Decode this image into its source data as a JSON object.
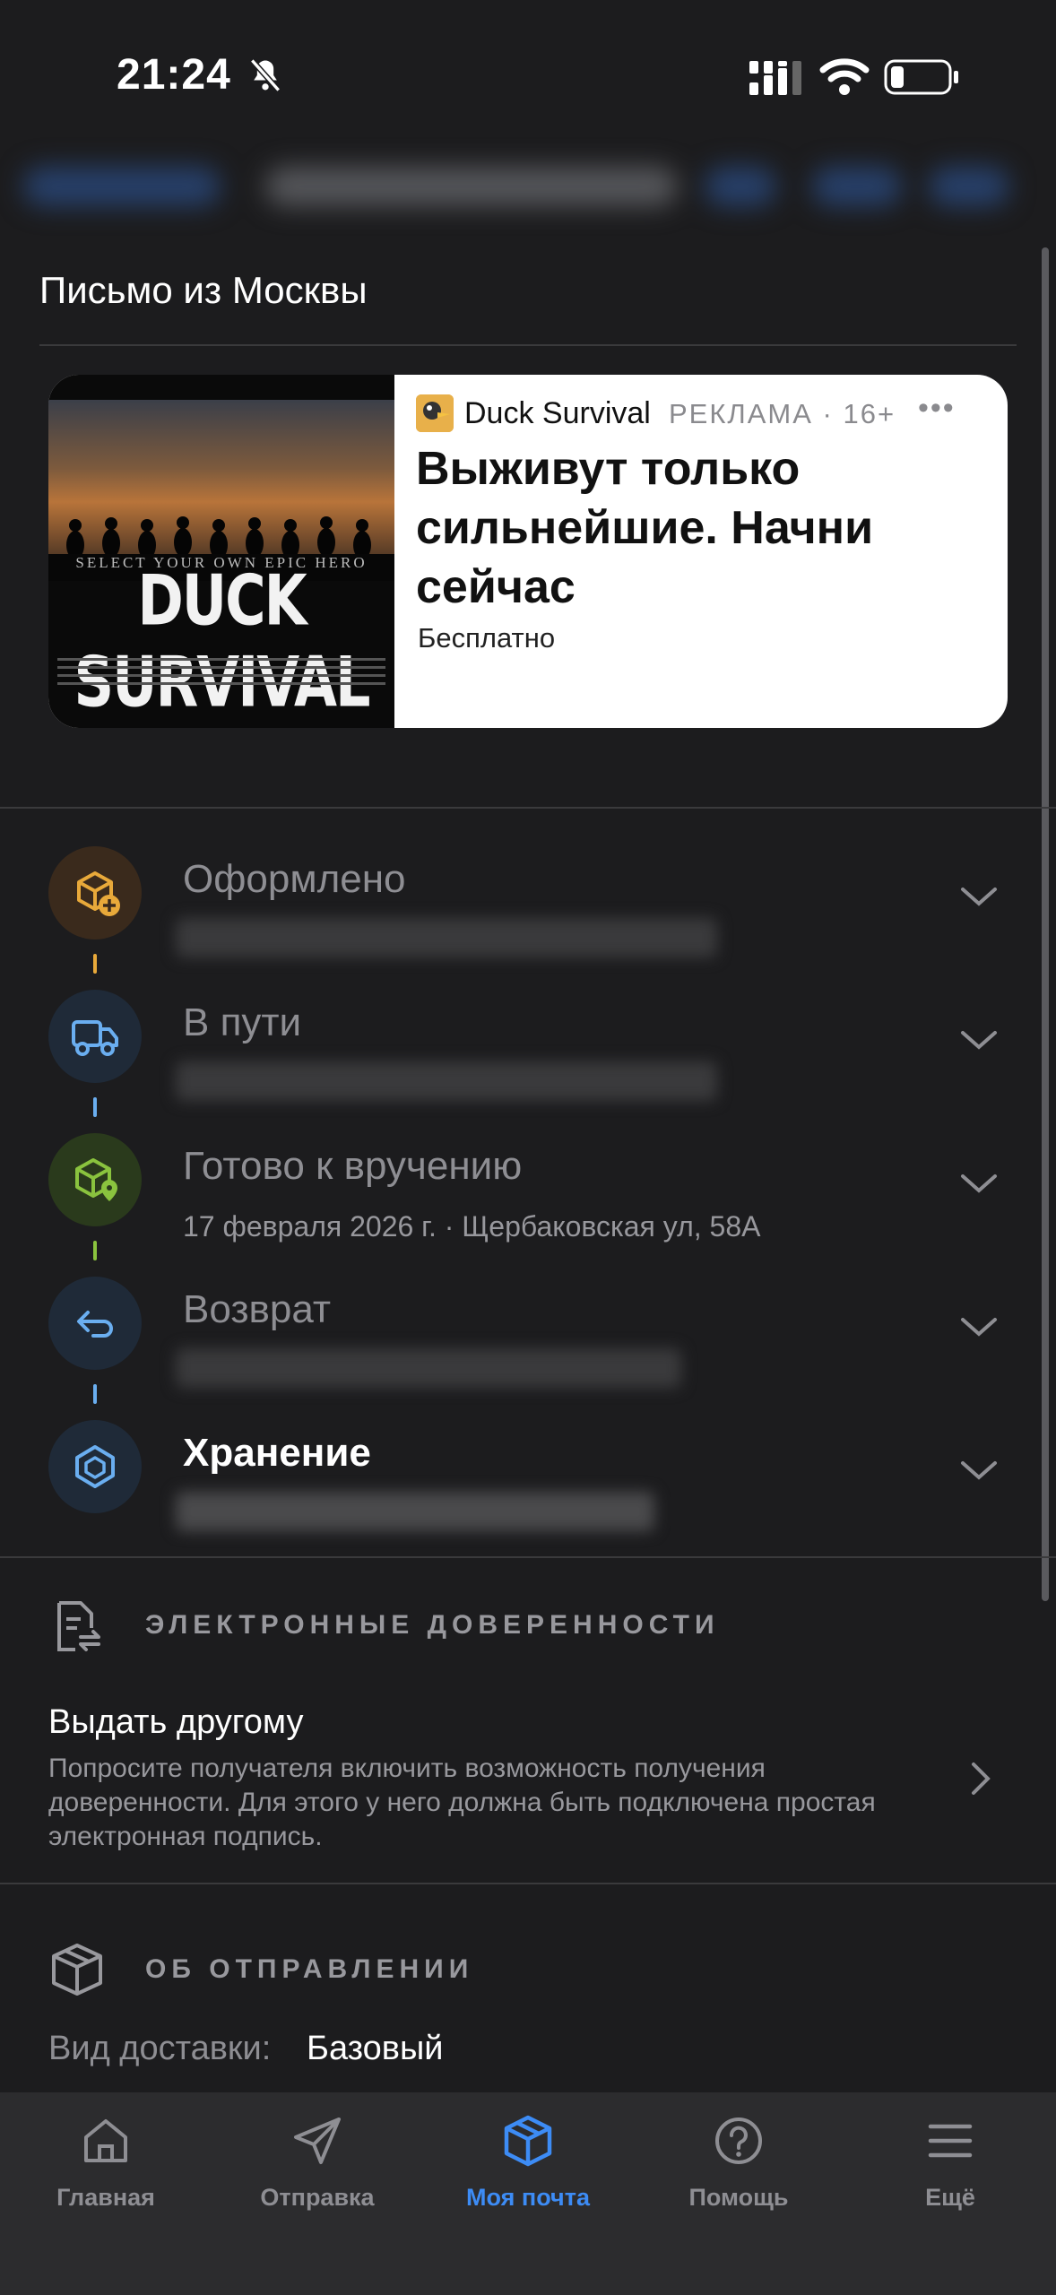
{
  "status_bar": {
    "time": "21:24"
  },
  "page_title": "Письмо из Москвы",
  "ad": {
    "brand": "Duck Survival",
    "label": "РЕКЛАМА",
    "age": "16+",
    "headline": "Выживут только сильнейшие. Начни сейчас",
    "price": "Бесплатно",
    "image_subtitle": "SELECT YOUR OWN EPIC HERO",
    "image_logo": "DUCK SURVIVAL"
  },
  "timeline": {
    "steps": [
      {
        "title": "Оформлено",
        "icon": "package-plus-icon",
        "color": "#e8a93a"
      },
      {
        "title": "В пути",
        "icon": "truck-icon",
        "color": "#6aaef0"
      },
      {
        "title": "Готово к вручению",
        "detail": "17 февраля 2026 г. · Щербаковская ул, 58А",
        "icon": "package-location-icon",
        "color": "#8ac33e"
      },
      {
        "title": "Возврат",
        "icon": "return-arrow-icon",
        "color": "#6aaef0"
      },
      {
        "title": "Хранение",
        "icon": "storage-box-icon",
        "color": "#6aaef0"
      }
    ]
  },
  "proxies": {
    "section_title": "ЭЛЕКТРОННЫЕ ДОВЕРЕННОСТИ",
    "give_title": "Выдать другому",
    "give_description": "Попросите получателя включить возможность получения доверенности. Для этого у него должна быть подключена простая электронная подпись."
  },
  "shipment": {
    "section_title": "ОБ ОТПРАВЛЕНИИ",
    "delivery_label": "Вид доставки:",
    "delivery_value": "Базовый"
  },
  "tabbar": {
    "items": [
      {
        "label": "Главная",
        "icon": "home-icon"
      },
      {
        "label": "Отправка",
        "icon": "send-icon"
      },
      {
        "label": "Моя почта",
        "icon": "box-icon",
        "active": true
      },
      {
        "label": "Помощь",
        "icon": "help-icon"
      },
      {
        "label": "Ещё",
        "icon": "menu-icon"
      }
    ],
    "active_color": "#3d8cf5"
  }
}
